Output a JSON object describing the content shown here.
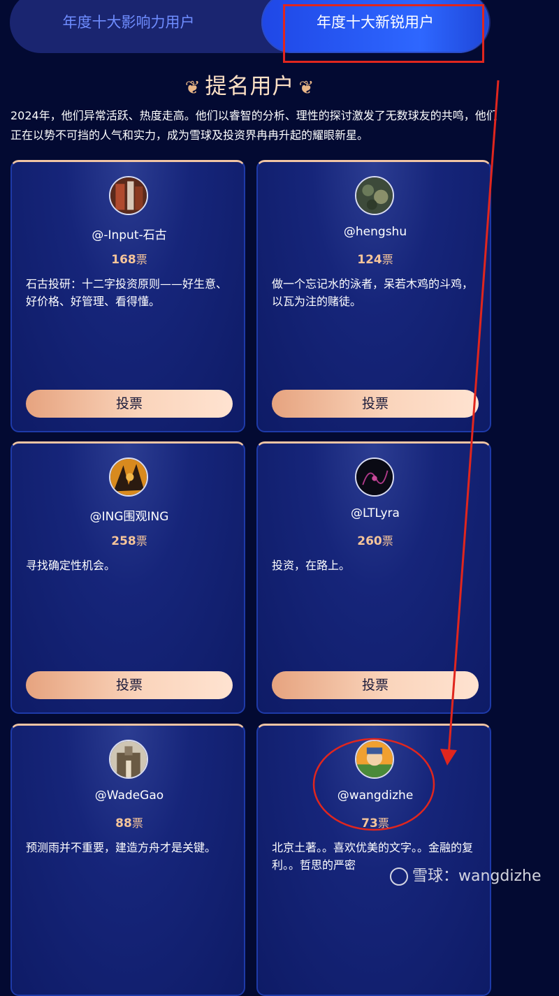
{
  "tabs": {
    "left_label": "年度十大影响力用户",
    "right_label": "年度十大新锐用户"
  },
  "section": {
    "title": "提名用户",
    "intro": "2024年，他们异常活跃、热度走高。他们以睿智的分析、理性的探讨激发了无数球友的共鸣，他们正在以势不可挡的人气和实力，成为雪球及投资界冉冉升起的耀眼新星。"
  },
  "vote_unit": "票",
  "vote_button_label": "投票",
  "cards": [
    {
      "username": "@-Input-石古",
      "votes": "168",
      "desc": "石古投研：十二字投资原则——好生意、好价格、好管理、看得懂。",
      "vote_label": "投票"
    },
    {
      "username": "@hengshu",
      "votes": "124",
      "desc": "做一个忘记水的泳者，呆若木鸡的斗鸡，以瓦为注的赌徒。",
      "vote_label": "投票"
    },
    {
      "username": "@ING围观ING",
      "votes": "258",
      "desc": "寻找确定性机会。",
      "vote_label": "投票"
    },
    {
      "username": "@LTLyra",
      "votes": "260",
      "desc": "投资，在路上。",
      "vote_label": "投票"
    },
    {
      "username": "@WadeGao",
      "votes": "88",
      "desc": "预测雨并不重要，建造方舟才是关键。",
      "vote_label": "投票"
    },
    {
      "username": "@wangdizhe",
      "votes": "73",
      "desc": "北京土著。。喜欢优美的文字。。金融的复利。。哲思的严密",
      "vote_label": "投票"
    }
  ],
  "watermark": {
    "text": "雪球：wangdizhe"
  },
  "colors": {
    "background": "#030a32",
    "accent_blue": "#2e67ff",
    "vote_gold": "#f6c59a",
    "annotation_red": "#e0261e"
  }
}
